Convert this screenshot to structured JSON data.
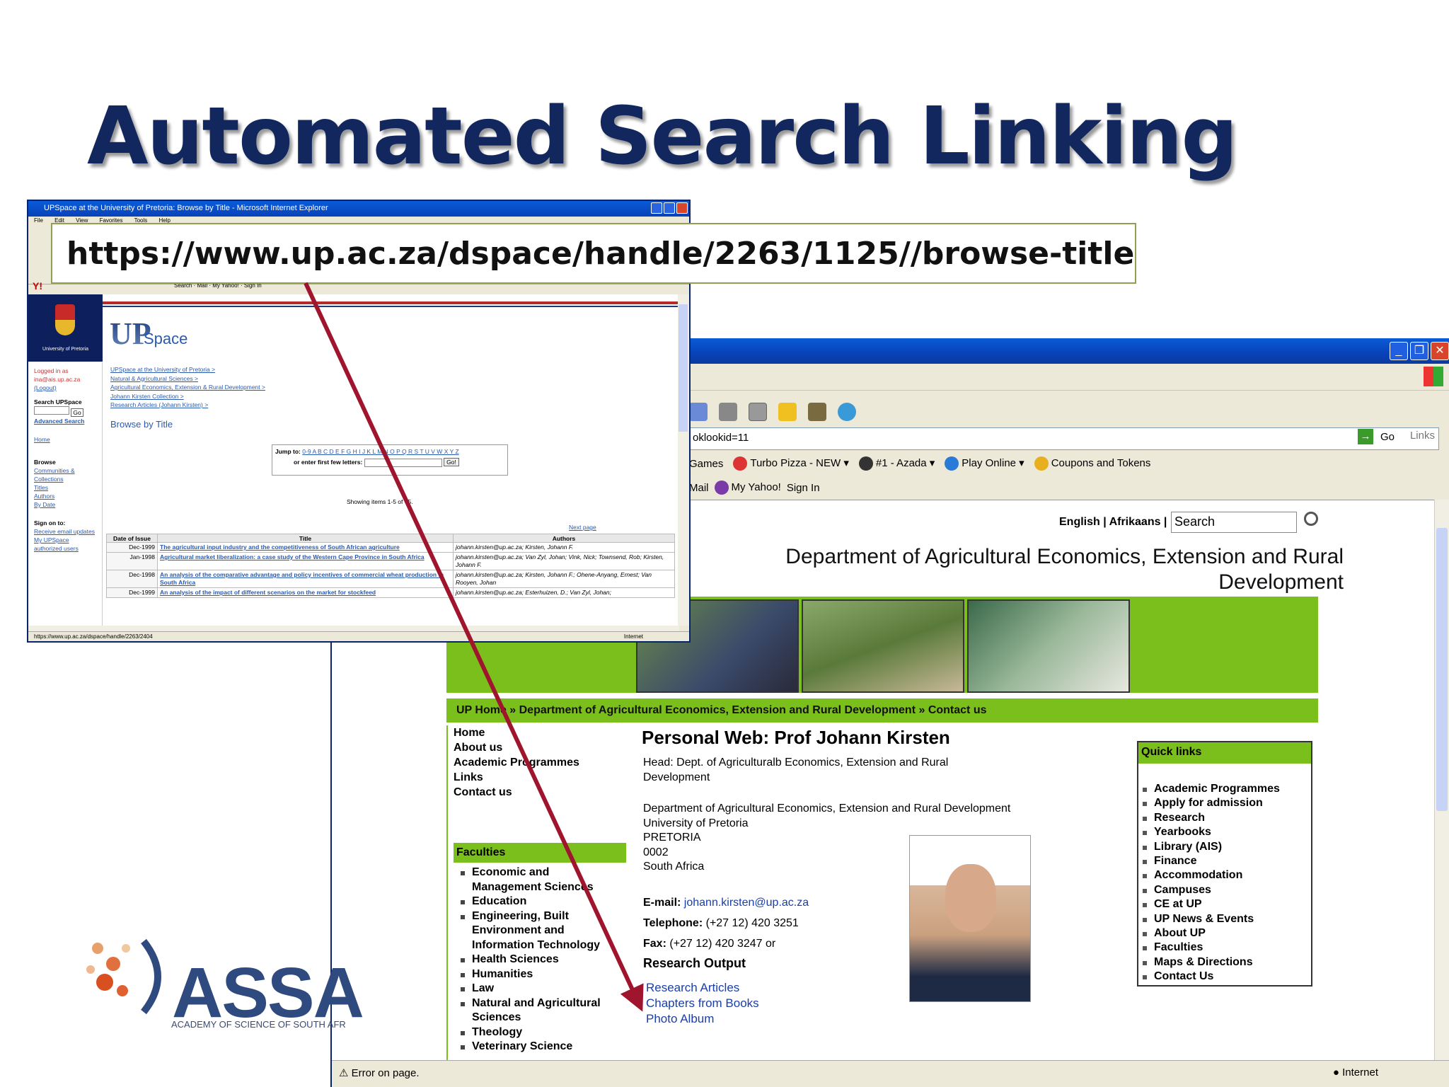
{
  "slide": {
    "title": "Automated Search Linking",
    "url_callout": "https://www.up.ac.za/dspace/handle/2263/1125//browse-title"
  },
  "logo": {
    "text": "ASSA",
    "subtitle": "ACADEMY OF SCIENCE OF SOUTH AFR"
  },
  "upspace_window": {
    "title_bar": "UPSpace at the University of Pretoria: Browse by Title - Microsoft Internet Explorer",
    "menu": [
      "File",
      "Edit",
      "View",
      "Favorites",
      "Tools",
      "Help"
    ],
    "yahoo_bar": "Search  ·  Mail  ·  My Yahoo!  ·  Sign In",
    "university_label": "University of Pretoria",
    "logo_up": "UP",
    "logo_space": "Space",
    "logged_in": "Logged in as",
    "logged_user": "ina@ais.up.ac.za",
    "logout": "(Logout)",
    "search_label": "Search UPSpace",
    "go": "Go",
    "advanced_search": "Advanced Search",
    "home": "Home",
    "browse_label": "Browse",
    "browse_links": [
      "Communities & Collections",
      "Titles",
      "Authors",
      "By Date"
    ],
    "sign_on": "Sign on to:",
    "sign_links": [
      "Receive email updates",
      "My UPSpace",
      "authorized users"
    ],
    "breadcrumbs": [
      "UPSpace at the University of Pretoria >",
      "Natural & Agricultural Sciences >",
      "Agricultural Economics, Extension & Rural Development >",
      "Johann Kirsten Collection >",
      "Research Articles (Johann Kirsten) >"
    ],
    "browse_title": "Browse by Title",
    "jump_to": "Jump to:",
    "jump_letters": "0-9 A B C D E F G H I J K L M N O P Q R S T U V W X Y Z",
    "first_letters": "or enter first few letters:",
    "go_button": "Go!",
    "showing": "Showing items 1-5 of 75.",
    "next_page": "Next page",
    "table": {
      "headers": [
        "Date of Issue",
        "Title",
        "Authors"
      ],
      "rows": [
        [
          "Dec-1999",
          "The agricultural input industry and the competitiveness of South African agriculture",
          "johann.kirsten@up.ac.za; Kirsten, Johann F."
        ],
        [
          "Jan-1998",
          "Agricultural market liberalization: a case study of the Western Cape Province in South Africa",
          "johann.kirsten@up.ac.za; Van Zyl, Johan; Vink, Nick; Townsend, Rob; Kirsten, Johann F."
        ],
        [
          "Dec-1998",
          "An analysis of the comparative advantage and policy incentives of commercial wheat production in South Africa",
          "johann.kirsten@up.ac.za; Kirsten, Johann F.; Ohene-Anyang, Ernest; Van Rooyen, Johan"
        ],
        [
          "Dec-1999",
          "An analysis of the impact of different scenarios on the market for stockfeed",
          "johann.kirsten@up.ac.za; Esterhuizen, D.; Van Zyl, Johan;"
        ]
      ]
    },
    "status_url": "https://www.up.ac.za/dspace/handle/2263/2404",
    "status_zone": "Internet"
  },
  "dept_window": {
    "address": "oklookid=11",
    "go": "Go",
    "links": "Links",
    "toolbar_items": [
      "Games",
      "Turbo Pizza - NEW",
      "#1 - Azada",
      "Play Online",
      "Coupons and Tokens"
    ],
    "yahoo_items": [
      "Mail",
      "My Yahoo!",
      "Sign In"
    ],
    "lang_english": "English",
    "lang_afrikaans": "Afrikaans",
    "search_value": "Search",
    "department_title": "Department of Agricultural Economics, Extension and Rural Development",
    "breadcrumb": "UP Home » Department of Agricultural Economics, Extension and Rural Development » Contact us",
    "nav": [
      "Home",
      "About us",
      "Academic Programmes",
      "Links",
      "Contact us"
    ],
    "faculties_heading": "Faculties",
    "faculties": [
      "Economic and Management Sciences",
      "Education",
      "Engineering, Built Environment and Information Technology",
      "Health Sciences",
      "Humanities",
      "Law",
      "Natural and Agricultural Sciences",
      "Theology",
      "Veterinary Science"
    ],
    "personal_title": "Personal Web: Prof Johann  Kirsten",
    "head_line": "Head: Dept. of Agriculturalb Economics, Extension and Rural Development",
    "address_lines": [
      "Department of Agricultural Economics, Extension and Rural Development",
      "University of Pretoria",
      "PRETORIA",
      "0002",
      "South Africa"
    ],
    "email_label": "E-mail:",
    "email": "johann.kirsten@up.ac.za",
    "phone_label": "Telephone:",
    "phone": "(+27 12) 420 3251",
    "fax_label": "Fax:",
    "fax": "(+27 12) 420 3247 or",
    "research_heading": "Research Output",
    "research_links": [
      "Research Articles",
      "Chapters from Books",
      "Photo Album"
    ],
    "quick_links_heading": "Quick links",
    "quick_links": [
      "Academic Programmes",
      "Apply for admission",
      "Research",
      "Yearbooks",
      "Library (AIS)",
      "Finance",
      "Accommodation",
      "Campuses",
      "CE at UP",
      "UP News & Events",
      "About UP",
      "Faculties",
      "Maps & Directions",
      "Contact Us"
    ],
    "status_text": "Error on page.",
    "status_zone": "Internet"
  },
  "colors": {
    "title": "#12275e",
    "green": "#7bbf1c",
    "arrow": "#a0152e",
    "ie_blue": "#0842b8"
  }
}
